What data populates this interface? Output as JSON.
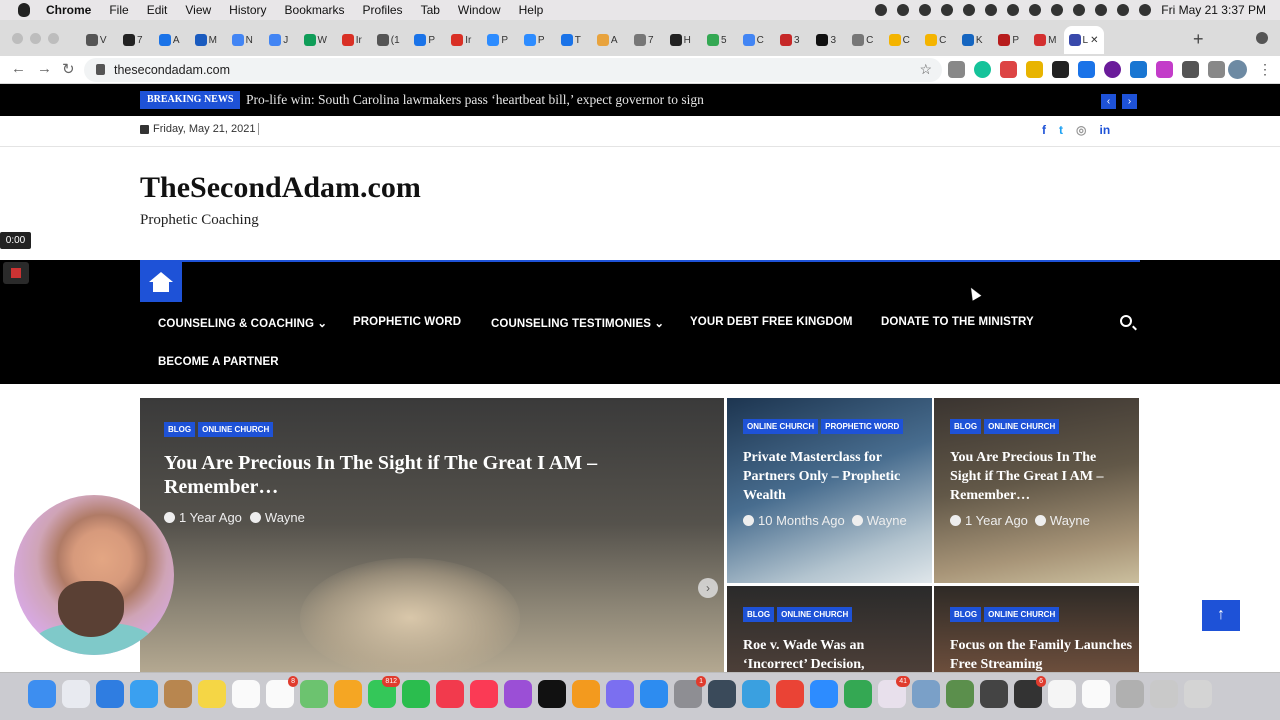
{
  "menubar": {
    "app": "Chrome",
    "items": [
      "File",
      "Edit",
      "View",
      "History",
      "Bookmarks",
      "Profiles",
      "Tab",
      "Window",
      "Help"
    ],
    "clock": "Fri May 21  3:37 PM"
  },
  "browser": {
    "tabs": [
      {
        "label": "V",
        "color": "#555"
      },
      {
        "label": "7",
        "color": "#222"
      },
      {
        "label": "A",
        "color": "#1a73e8"
      },
      {
        "label": "M",
        "color": "#1a5bbf"
      },
      {
        "label": "N",
        "color": "#4285f4"
      },
      {
        "label": "J",
        "color": "#4285f4"
      },
      {
        "label": "W",
        "color": "#0f9d58"
      },
      {
        "label": "Ir",
        "color": "#d93025"
      },
      {
        "label": "(1",
        "color": "#555"
      },
      {
        "label": "P",
        "color": "#1a73e8"
      },
      {
        "label": "Ir",
        "color": "#d93025"
      },
      {
        "label": "P",
        "color": "#2d8cff"
      },
      {
        "label": "P",
        "color": "#2d8cff"
      },
      {
        "label": "T",
        "color": "#1a73e8"
      },
      {
        "label": "A",
        "color": "#e8a33d"
      },
      {
        "label": "7",
        "color": "#777"
      },
      {
        "label": "H",
        "color": "#222"
      },
      {
        "label": "5",
        "color": "#34a853"
      },
      {
        "label": "C",
        "color": "#4285f4"
      },
      {
        "label": "3",
        "color": "#c62828"
      },
      {
        "label": "3",
        "color": "#111"
      },
      {
        "label": "C",
        "color": "#777"
      },
      {
        "label": "C",
        "color": "#f4b400"
      },
      {
        "label": "C",
        "color": "#f4b400"
      },
      {
        "label": "K",
        "color": "#1565c0"
      },
      {
        "label": "P",
        "color": "#b71c1c"
      },
      {
        "label": "M",
        "color": "#d32f2f"
      },
      {
        "label": "L",
        "color": "#3949ab"
      }
    ],
    "active_tab_close": "✕",
    "new_tab": "+",
    "url": "thesecondadam.com"
  },
  "site": {
    "breaking_label": "BREAKING NEWS",
    "breaking_text": "Pro-life win: South Carolina lawmakers pass ‘heartbeat bill,’ expect governor to sign",
    "date": "Friday, May 21, 2021",
    "social": [
      {
        "name": "facebook-icon",
        "glyph": "f",
        "color": "#1e52d7"
      },
      {
        "name": "twitter-icon",
        "glyph": "t",
        "color": "#1da1f2"
      },
      {
        "name": "instagram-icon",
        "glyph": "◎",
        "color": "#999"
      },
      {
        "name": "linkedin-icon",
        "glyph": "in",
        "color": "#1e52d7"
      }
    ],
    "title": "TheSecondAdam.com",
    "tagline": "Prophetic Coaching",
    "accent": "#1e52d7",
    "nav": {
      "counseling": "COUNSELING & COACHING",
      "prophetic": "PROPHETIC WORD",
      "testimonies": "COUNSELING TESTIMONIES",
      "debt": "YOUR DEBT FREE KINGDOM",
      "donate": "DONATE TO THE MINISTRY",
      "partner": "BECOME A PARTNER"
    }
  },
  "featured": {
    "tags": [
      "BLOG",
      "ONLINE CHURCH"
    ],
    "title": "You Are Precious In The Sight if The Great I AM – Remember…",
    "age": "1 Year Ago",
    "author": "Wayne"
  },
  "cards": [
    {
      "tags": [
        "ONLINE CHURCH",
        "PROPHETIC WORD"
      ],
      "title": "Private Masterclass for Partners Only – Prophetic Wealth",
      "age": "10 Months Ago",
      "author": "Wayne"
    },
    {
      "tags": [
        "BLOG",
        "ONLINE CHURCH"
      ],
      "title": "You Are Precious In The Sight if The Great I AM – Remember…",
      "age": "1 Year Ago",
      "author": "Wayne"
    },
    {
      "tags": [
        "BLOG",
        "ONLINE CHURCH"
      ],
      "title": "Roe v. Wade Was an ‘Incorrect’ Decision,"
    },
    {
      "tags": [
        "BLOG",
        "ONLINE CHURCH"
      ],
      "title": "Focus on the Family Launches Free Streaming"
    }
  ],
  "recording": {
    "time": "0:00"
  },
  "dock": {
    "apps": [
      {
        "name": "finder-icon",
        "color": "#3d8ef0"
      },
      {
        "name": "launchpad-icon",
        "color": "#e8eaf0"
      },
      {
        "name": "mail-icon",
        "color": "#2f7de1"
      },
      {
        "name": "safari-icon",
        "color": "#3aa0f0"
      },
      {
        "name": "contacts-icon",
        "color": "#b8864f"
      },
      {
        "name": "notes-icon",
        "color": "#f5d645"
      },
      {
        "name": "calendar-icon",
        "color": "#fafafa"
      },
      {
        "name": "reminders-icon",
        "color": "#fafafa",
        "badge": "8"
      },
      {
        "name": "maps-icon",
        "color": "#6cc36f"
      },
      {
        "name": "photos-icon",
        "color": "#f5a623"
      },
      {
        "name": "messages-icon",
        "color": "#34c759",
        "badge": "812"
      },
      {
        "name": "facetime-icon",
        "color": "#2bbd4e"
      },
      {
        "name": "news-icon",
        "color": "#f23a4d"
      },
      {
        "name": "music-icon",
        "color": "#fb3a55"
      },
      {
        "name": "podcasts-icon",
        "color": "#9b4fd6"
      },
      {
        "name": "tv-icon",
        "color": "#111"
      },
      {
        "name": "books-icon",
        "color": "#f39a1e"
      },
      {
        "name": "spark-icon",
        "color": "#7b6ff0"
      },
      {
        "name": "appstore-icon",
        "color": "#2d8cf0"
      },
      {
        "name": "settings-icon",
        "color": "#8e8e93",
        "badge": "1"
      },
      {
        "name": "screenflow-icon",
        "color": "#3a4a5a"
      },
      {
        "name": "frog-icon",
        "color": "#3aa0e0"
      },
      {
        "name": "chrome-icon",
        "color": "#ea4335"
      },
      {
        "name": "zoom-icon",
        "color": "#2d8cff"
      },
      {
        "name": "numbers-icon",
        "color": "#34a853"
      },
      {
        "name": "slack-icon",
        "color": "#e8e0ec",
        "badge": "41"
      },
      {
        "name": "preview-icon",
        "color": "#7aa0c8"
      },
      {
        "name": "keynote-icon",
        "color": "#5b8f4c"
      },
      {
        "name": "printer-icon",
        "color": "#444"
      },
      {
        "name": "printer2-icon",
        "color": "#333",
        "badge": "6"
      },
      {
        "name": "textedit-icon",
        "color": "#f5f5f5"
      },
      {
        "name": "document-icon",
        "color": "#fafafa"
      },
      {
        "name": "downloads-icon",
        "color": "#b0b0b0"
      },
      {
        "name": "folder-icon",
        "color": "#c9c9c9"
      },
      {
        "name": "trash-icon",
        "color": "#d4d4d4"
      }
    ]
  }
}
